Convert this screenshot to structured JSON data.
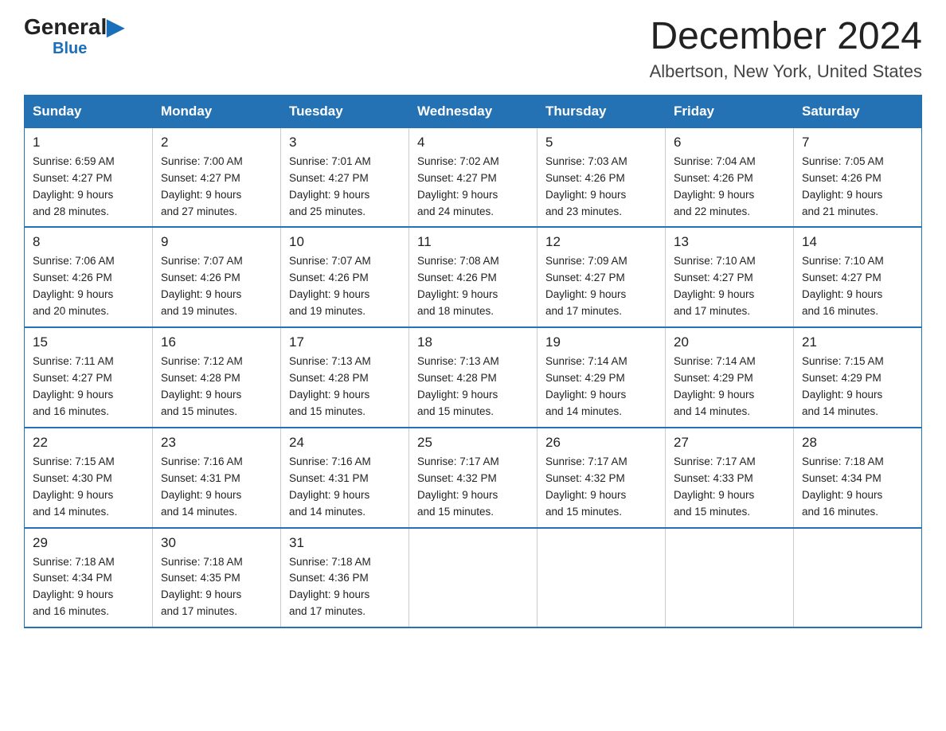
{
  "header": {
    "logo_general": "General",
    "logo_blue": "Blue",
    "main_title": "December 2024",
    "subtitle": "Albertson, New York, United States"
  },
  "days_of_week": [
    "Sunday",
    "Monday",
    "Tuesday",
    "Wednesday",
    "Thursday",
    "Friday",
    "Saturday"
  ],
  "weeks": [
    [
      {
        "day": "1",
        "sunrise": "6:59 AM",
        "sunset": "4:27 PM",
        "daylight": "9 hours and 28 minutes."
      },
      {
        "day": "2",
        "sunrise": "7:00 AM",
        "sunset": "4:27 PM",
        "daylight": "9 hours and 27 minutes."
      },
      {
        "day": "3",
        "sunrise": "7:01 AM",
        "sunset": "4:27 PM",
        "daylight": "9 hours and 25 minutes."
      },
      {
        "day": "4",
        "sunrise": "7:02 AM",
        "sunset": "4:27 PM",
        "daylight": "9 hours and 24 minutes."
      },
      {
        "day": "5",
        "sunrise": "7:03 AM",
        "sunset": "4:26 PM",
        "daylight": "9 hours and 23 minutes."
      },
      {
        "day": "6",
        "sunrise": "7:04 AM",
        "sunset": "4:26 PM",
        "daylight": "9 hours and 22 minutes."
      },
      {
        "day": "7",
        "sunrise": "7:05 AM",
        "sunset": "4:26 PM",
        "daylight": "9 hours and 21 minutes."
      }
    ],
    [
      {
        "day": "8",
        "sunrise": "7:06 AM",
        "sunset": "4:26 PM",
        "daylight": "9 hours and 20 minutes."
      },
      {
        "day": "9",
        "sunrise": "7:07 AM",
        "sunset": "4:26 PM",
        "daylight": "9 hours and 19 minutes."
      },
      {
        "day": "10",
        "sunrise": "7:07 AM",
        "sunset": "4:26 PM",
        "daylight": "9 hours and 19 minutes."
      },
      {
        "day": "11",
        "sunrise": "7:08 AM",
        "sunset": "4:26 PM",
        "daylight": "9 hours and 18 minutes."
      },
      {
        "day": "12",
        "sunrise": "7:09 AM",
        "sunset": "4:27 PM",
        "daylight": "9 hours and 17 minutes."
      },
      {
        "day": "13",
        "sunrise": "7:10 AM",
        "sunset": "4:27 PM",
        "daylight": "9 hours and 17 minutes."
      },
      {
        "day": "14",
        "sunrise": "7:10 AM",
        "sunset": "4:27 PM",
        "daylight": "9 hours and 16 minutes."
      }
    ],
    [
      {
        "day": "15",
        "sunrise": "7:11 AM",
        "sunset": "4:27 PM",
        "daylight": "9 hours and 16 minutes."
      },
      {
        "day": "16",
        "sunrise": "7:12 AM",
        "sunset": "4:28 PM",
        "daylight": "9 hours and 15 minutes."
      },
      {
        "day": "17",
        "sunrise": "7:13 AM",
        "sunset": "4:28 PM",
        "daylight": "9 hours and 15 minutes."
      },
      {
        "day": "18",
        "sunrise": "7:13 AM",
        "sunset": "4:28 PM",
        "daylight": "9 hours and 15 minutes."
      },
      {
        "day": "19",
        "sunrise": "7:14 AM",
        "sunset": "4:29 PM",
        "daylight": "9 hours and 14 minutes."
      },
      {
        "day": "20",
        "sunrise": "7:14 AM",
        "sunset": "4:29 PM",
        "daylight": "9 hours and 14 minutes."
      },
      {
        "day": "21",
        "sunrise": "7:15 AM",
        "sunset": "4:29 PM",
        "daylight": "9 hours and 14 minutes."
      }
    ],
    [
      {
        "day": "22",
        "sunrise": "7:15 AM",
        "sunset": "4:30 PM",
        "daylight": "9 hours and 14 minutes."
      },
      {
        "day": "23",
        "sunrise": "7:16 AM",
        "sunset": "4:31 PM",
        "daylight": "9 hours and 14 minutes."
      },
      {
        "day": "24",
        "sunrise": "7:16 AM",
        "sunset": "4:31 PM",
        "daylight": "9 hours and 14 minutes."
      },
      {
        "day": "25",
        "sunrise": "7:17 AM",
        "sunset": "4:32 PM",
        "daylight": "9 hours and 15 minutes."
      },
      {
        "day": "26",
        "sunrise": "7:17 AM",
        "sunset": "4:32 PM",
        "daylight": "9 hours and 15 minutes."
      },
      {
        "day": "27",
        "sunrise": "7:17 AM",
        "sunset": "4:33 PM",
        "daylight": "9 hours and 15 minutes."
      },
      {
        "day": "28",
        "sunrise": "7:18 AM",
        "sunset": "4:34 PM",
        "daylight": "9 hours and 16 minutes."
      }
    ],
    [
      {
        "day": "29",
        "sunrise": "7:18 AM",
        "sunset": "4:34 PM",
        "daylight": "9 hours and 16 minutes."
      },
      {
        "day": "30",
        "sunrise": "7:18 AM",
        "sunset": "4:35 PM",
        "daylight": "9 hours and 17 minutes."
      },
      {
        "day": "31",
        "sunrise": "7:18 AM",
        "sunset": "4:36 PM",
        "daylight": "9 hours and 17 minutes."
      },
      null,
      null,
      null,
      null
    ]
  ]
}
